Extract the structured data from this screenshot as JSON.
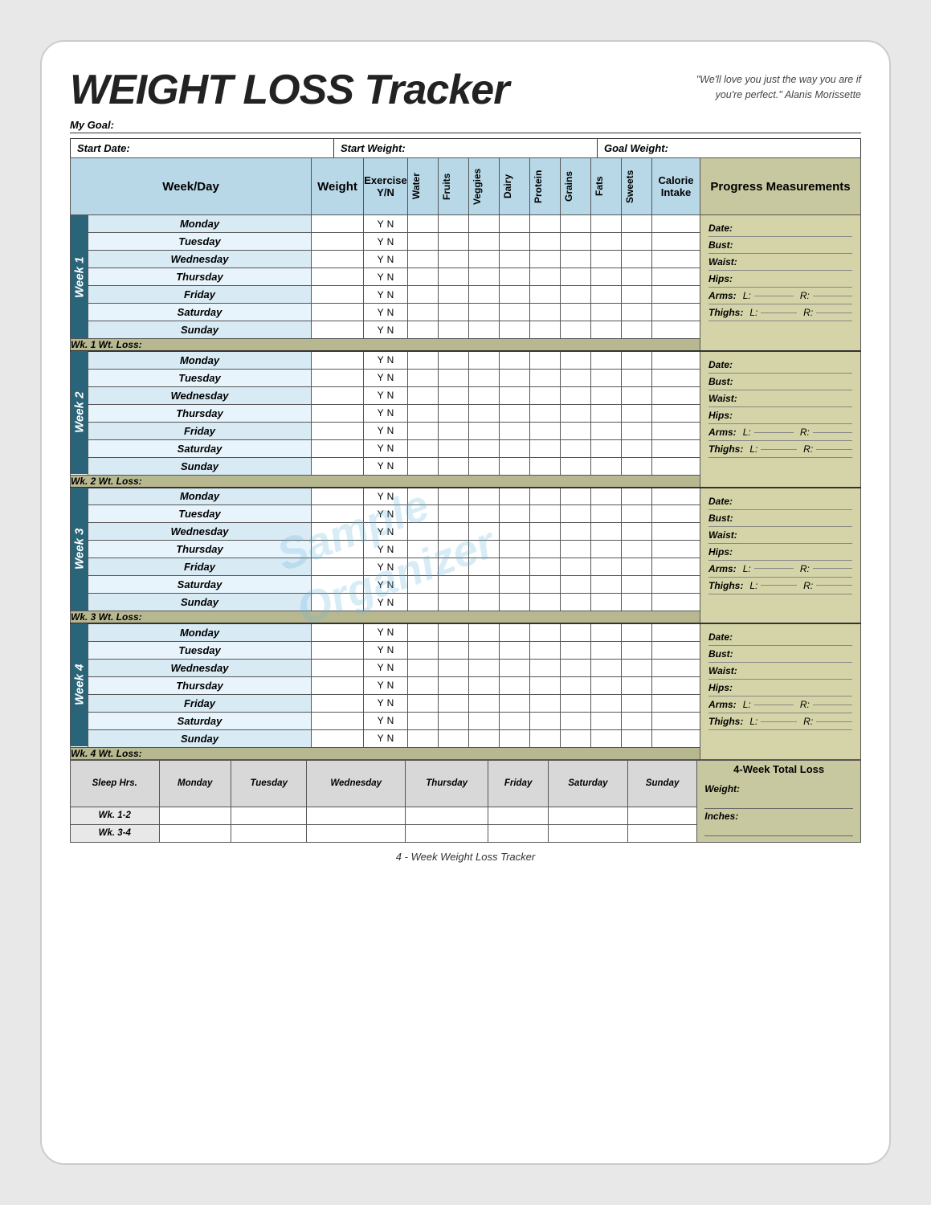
{
  "title": "WEIGHT LOSS Tracker",
  "quote": "\"We'll love you just the way you are if you're perfect.\"  Alanis Morissette",
  "my_goal_label": "My Goal:",
  "start_date_label": "Start Date:",
  "start_weight_label": "Start Weight:",
  "goal_weight_label": "Goal Weight:",
  "headers": {
    "week_day": "Week/Day",
    "weight": "Weight",
    "exercise": "Exercise Y/N",
    "water": "Water",
    "fruits": "Fruits",
    "veggies": "Veggies",
    "dairy": "Dairy",
    "protein": "Protein",
    "grains": "Grains",
    "fats": "Fats",
    "sweets": "Sweets",
    "calorie_intake": "Calorie Intake",
    "progress": "Progress Measurements"
  },
  "days": [
    "Monday",
    "Tuesday",
    "Wednesday",
    "Thursday",
    "Friday",
    "Saturday",
    "Sunday"
  ],
  "weeks": [
    {
      "label": "Week 1",
      "wt_loss": "Wk. 1 Wt. Loss:"
    },
    {
      "label": "Week 2",
      "wt_loss": "Wk. 2 Wt. Loss:"
    },
    {
      "label": "Week 3",
      "wt_loss": "Wk. 3 Wt. Loss:"
    },
    {
      "label": "Week 4",
      "wt_loss": "Wk. 4 Wt. Loss:"
    }
  ],
  "progress_fields": [
    "Date:",
    "Bust:",
    "Waist:",
    "Hips:"
  ],
  "arms_label": "Arms:",
  "arms_l": "L:",
  "arms_r": "R:",
  "thighs_label": "Thighs:",
  "thighs_l": "L:",
  "thighs_r": "R:",
  "sleep_label": "Sleep Hrs.",
  "sleep_days": [
    "Monday",
    "Tuesday",
    "Wednesday",
    "Thursday",
    "Friday",
    "Saturday",
    "Sunday"
  ],
  "sleep_weeks": [
    "Wk. 1-2",
    "Wk. 3-4"
  ],
  "four_week_total": "4-Week Total Loss",
  "weight_label": "Weight:",
  "inches_label": "Inches:",
  "footer": "4 - Week Weight Loss Tracker",
  "yn_y": "Y",
  "yn_n": "N"
}
